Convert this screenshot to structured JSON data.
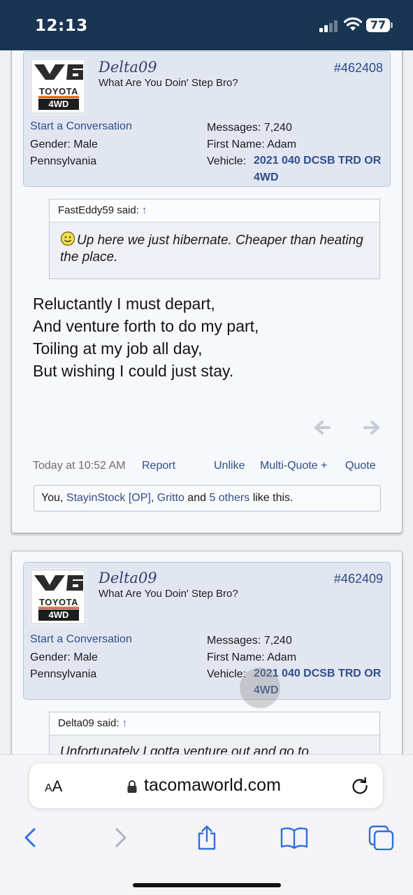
{
  "status_bar": {
    "time": "12:13",
    "battery": "77"
  },
  "posts": [
    {
      "username": "Delta09",
      "user_title": "What Are You Doin' Step Bro?",
      "post_number": "#462408",
      "avatar_text": {
        "badge": "V6",
        "make": "TOYOTA",
        "drive": "4WD"
      },
      "start_conversation": "Start a Conversation",
      "gender": "Gender:  Male",
      "location": "Pennsylvania",
      "messages": "Messages:  7,240",
      "first_name": "First Name:  Adam",
      "vehicle_label": "Vehicle:",
      "vehicle_value": "2021 040 DCSB TRD OR 4WD",
      "quote": {
        "author": "FastEddy59 said:",
        "up_arrow": "↑",
        "text": "Up here we just hibernate. Cheaper than heating the place."
      },
      "body_lines": [
        "Reluctantly I must depart,",
        "And venture forth to do my part,",
        "Toiling at my job all day,",
        "But wishing I could just stay."
      ],
      "timestamp": "Today at 10:52 AM",
      "report": "Report",
      "unlike": "Unlike",
      "multiquote": "Multi-Quote +",
      "quote_action": "Quote",
      "likes": {
        "you": "You, ",
        "user1": "StayinStock [OP]",
        "sep": ", ",
        "user2": "Gritto",
        "and": " and ",
        "others": "5 others",
        "tail": " like this."
      }
    },
    {
      "username": "Delta09",
      "user_title": "What Are You Doin' Step Bro?",
      "post_number": "#462409",
      "avatar_text": {
        "badge": "V6",
        "make": "TOYOTA",
        "drive": "4WD"
      },
      "start_conversation": "Start a Conversation",
      "gender": "Gender:  Male",
      "location": "Pennsylvania",
      "messages": "Messages:  7,240",
      "first_name": "First Name:  Adam",
      "vehicle_label": "Vehicle:",
      "vehicle_value": "2021 040 DCSB TRD OR 4WD",
      "quote": {
        "author": "Delta09 said:",
        "up_arrow": "↑",
        "text": "Unfortunately I gotta venture out and go to"
      }
    }
  ],
  "safari": {
    "aa_small": "A",
    "aa_big": "A",
    "url": "tacomaworld.com"
  }
}
